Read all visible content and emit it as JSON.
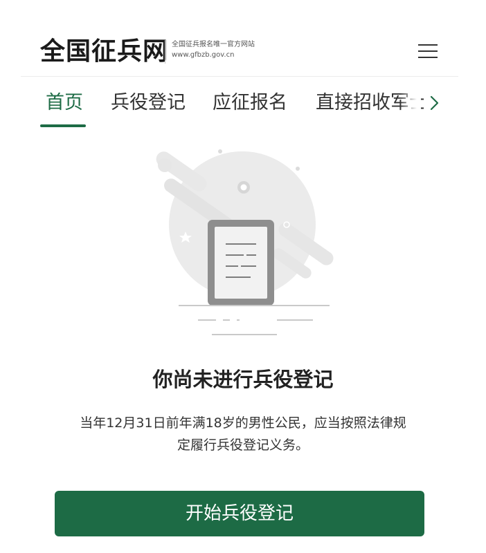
{
  "header": {
    "site_title": "全国征兵网",
    "subtitle_line1": "全国征兵报名唯一官方网站",
    "subtitle_line2": "www.gfbzb.gov.cn",
    "menu_icon": "hamburger-menu-icon"
  },
  "tabs": [
    {
      "label": "首页",
      "active": true
    },
    {
      "label": "兵役登记",
      "active": false
    },
    {
      "label": "应征报名",
      "active": false
    },
    {
      "label": "直接招收军士",
      "active": false
    }
  ],
  "tabs_more_icon": "chevron-right-icon",
  "empty_state": {
    "illustration": "document-empty-illustration",
    "title": "你尚未进行兵役登记",
    "description_line1": "当年12月31日前年满18岁的男性公民，应当按照法律规",
    "description_line2": "定履行兵役登记义务。"
  },
  "primary_action": {
    "label": "开始兵役登记"
  },
  "colors": {
    "accent": "#1d6b45",
    "text": "#222222",
    "illustration_gray": "#e6e6e6"
  }
}
